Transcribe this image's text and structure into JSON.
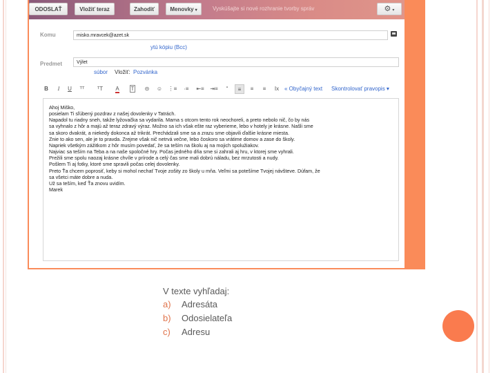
{
  "toolbar": {
    "send_label": "ODOSLAŤ",
    "insert_label": "Vložiť teraz",
    "discard_label": "Zahodiť",
    "labels_label": "Menovky",
    "notice": "Vyskúšajte si nové rozhranie tvorby správ",
    "gear_glyph": "⚙",
    "caret": "▾"
  },
  "compose": {
    "to_label": "Komu",
    "to_value": "misko.mravcek@azet.sk",
    "bcc_link": "ytú kópiu (Bcc)",
    "subject_label": "Predmet",
    "subject_value": "Výlet",
    "attach_link": "súbor",
    "insert_label": "Vložiť:",
    "invite_link": "Pozvánka"
  },
  "format_bar": {
    "bold": "B",
    "italic": "I",
    "underline": "U",
    "plain_text_link": "« Obyčajný text",
    "spellcheck_link": "Skontrolovať pravopis ▾"
  },
  "message_body": [
    "Ahoj Miško,",
    "posielam Ti sľúbený pozdrav z našej dovolenky v Tatrách.",
    "Napadol tu riadny sneh, takže lyžovačka sa vydarila. Mama s otcom tento rok neochoreli, a preto nebolo nič, čo by nás",
    "sa vyhnalo z hôr a majú až teraz zdravý výraz. Možno sa ich však ešte raz vyberieme, lebo v hotely je krásne. Našli sme",
    "sa skoro dvakrát, a niekedy dokonca až trikrát. Prechádzali sme sa a zrazu sme objavili ďalšie krásne miesta.",
    "Znie to ako sen, ale je to pravda. Zrejme však nič netrvá večne, lebo čoskoro sa vrátime domov a zase do školy.",
    "Napriek všetkým zážitkom z hôr musím povedať, že sa teším na školu aj na mojich spolužiakov.",
    "Najviac sa teším na Teba a na naše spoločné hry. Počas jedného dňa sme si zahrali aj hru, v ktorej sme vyhrali.",
    "Prežili sme spolu naozaj krásne chvíle v prírode a celý čas sme mali dobrú náladu, bez mrzutosti a nudy.",
    "Pošlem Ti aj fotky, ktoré sme spravili počas celej dovolenky.",
    "Preto Ťa chcem poprosiť, keby si mohol nechať Tvoje zošity zo školy u mňa. Veľmi sa potešíme Tvojej návšteve. Dúfam, že",
    "sa všetci máte dobre a nuda.",
    "Už sa teším, keď Ťa znovu uvidím.",
    "Marek"
  ],
  "question": "V texte vyhľadaj:",
  "answers": [
    {
      "letter": "a)",
      "text": "Adresáta"
    },
    {
      "letter": "b)",
      "text": "Odosielateľa"
    },
    {
      "letter": "c)",
      "text": "Adresu"
    }
  ],
  "colors": {
    "frame_orange": "#fa8b59",
    "accent_orange": "#fa7b4e",
    "link_blue": "#3366cc"
  }
}
